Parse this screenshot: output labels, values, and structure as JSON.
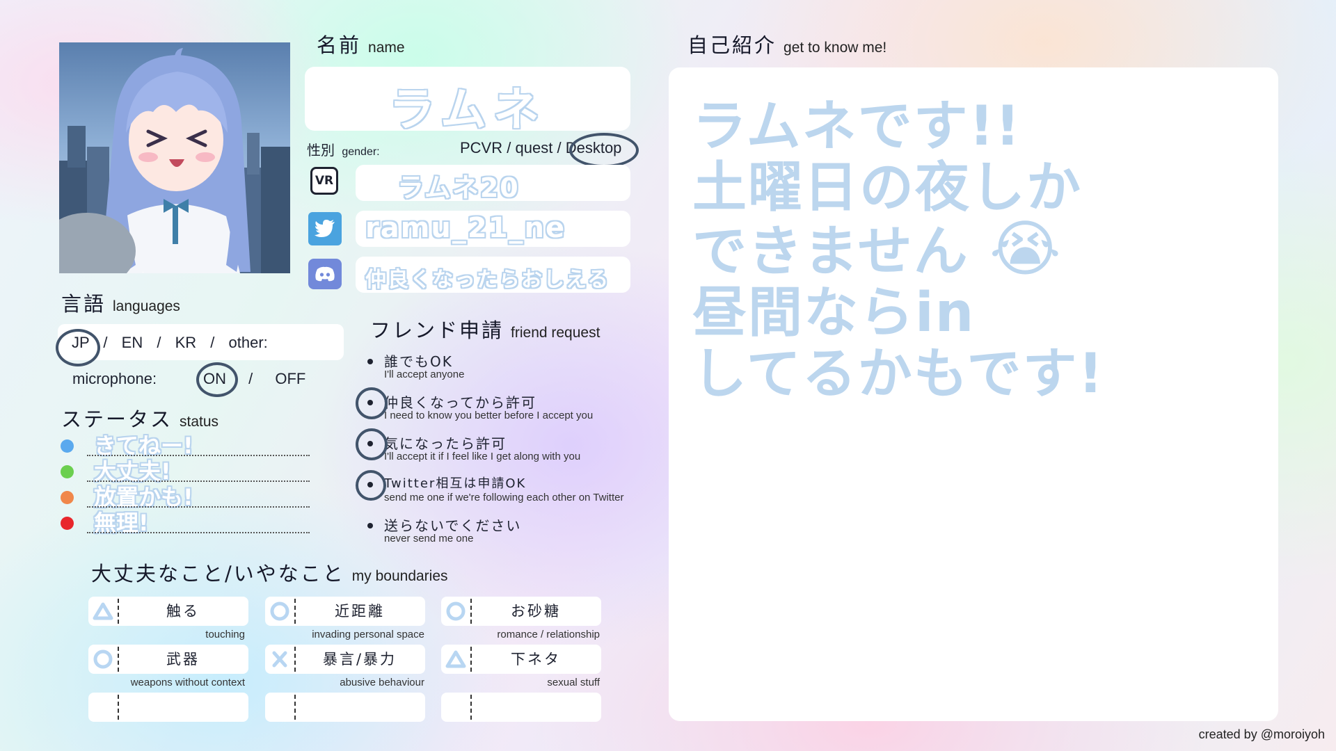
{
  "avatar": {
    "alt": "avatar"
  },
  "name_section": {
    "label_jp": "名前",
    "label_en": "name",
    "name_value": "ラムネ"
  },
  "gender": {
    "label_jp": "性別",
    "label_en": "gender:"
  },
  "platform": {
    "pcvr": "PCVR",
    "sep1": "/",
    "quest": "quest",
    "sep2": "/",
    "desktop": "Desktop",
    "selected": "Desktop"
  },
  "links": {
    "vr_icon_text": "VR",
    "vrchat_name": "ラムネ20",
    "twitter_handle": "ramu_21_ne",
    "discord_text": "仲良くなったらおしえる"
  },
  "languages": {
    "label_jp": "言語",
    "label_en": "languages",
    "options": [
      "JP",
      "/",
      "EN",
      "/",
      "KR",
      "/",
      "other:"
    ],
    "selected": "JP",
    "microphone_label": "microphone:",
    "mic_on": "ON",
    "mic_sep": "/",
    "mic_off": "OFF",
    "mic_selected": "ON"
  },
  "status": {
    "label_jp": "ステータス",
    "label_en": "status",
    "items": [
      {
        "text": "きてねー!",
        "color": "#5aa9ee"
      },
      {
        "text": "大丈夫!",
        "color": "#6bcf4f"
      },
      {
        "text": "放置かも!",
        "color": "#f0874a"
      },
      {
        "text": "無理!",
        "color": "#e8262b"
      }
    ]
  },
  "friend_request": {
    "label_jp": "フレンド申請",
    "label_en": "friend request",
    "items": [
      {
        "jp": "誰でもOK",
        "en": "I'll accept anyone",
        "circled": false
      },
      {
        "jp": "仲良くなってから許可",
        "en": "I need to know you better before I accept you",
        "circled": true
      },
      {
        "jp": "気になったら許可",
        "en": "I'll accept it if I feel like I get along with you",
        "circled": true
      },
      {
        "jp": "Twitter相互は申請OK",
        "en": "send me one if we're following each other on Twitter",
        "circled": true
      },
      {
        "jp": "送らないでください",
        "en": "never send me one",
        "circled": false
      }
    ]
  },
  "boundaries": {
    "label_jp": "大丈夫なこと/いやなこと",
    "label_en": "my boundaries",
    "items": [
      {
        "symbol": "triangle",
        "jp": "触る",
        "en": "touching"
      },
      {
        "symbol": "circle",
        "jp": "近距離",
        "en": "invading personal space"
      },
      {
        "symbol": "circle",
        "jp": "お砂糖",
        "en": "romance / relationship"
      },
      {
        "symbol": "circle",
        "jp": "武器",
        "en": "weapons without context"
      },
      {
        "symbol": "cross",
        "jp": "暴言/暴力",
        "en": "abusive behaviour"
      },
      {
        "symbol": "triangle",
        "jp": "下ネタ",
        "en": "sexual stuff"
      },
      {
        "symbol": "",
        "jp": "",
        "en": ""
      },
      {
        "symbol": "",
        "jp": "",
        "en": ""
      },
      {
        "symbol": "",
        "jp": "",
        "en": ""
      }
    ]
  },
  "intro": {
    "label_jp": "自己紹介",
    "label_en": "get to know me!",
    "lines": [
      "ラムネです!!",
      "土曜日の夜しか",
      "できません",
      "昼間ならin",
      "してるかもです!"
    ],
    "emoji": "😭"
  },
  "credit": "created by @moroiyoh",
  "colors": {
    "accent_light_blue": "#b8d6f2",
    "circle_mark": "#42546b",
    "discord": "#7289da",
    "twitter": "#4aa3df"
  }
}
